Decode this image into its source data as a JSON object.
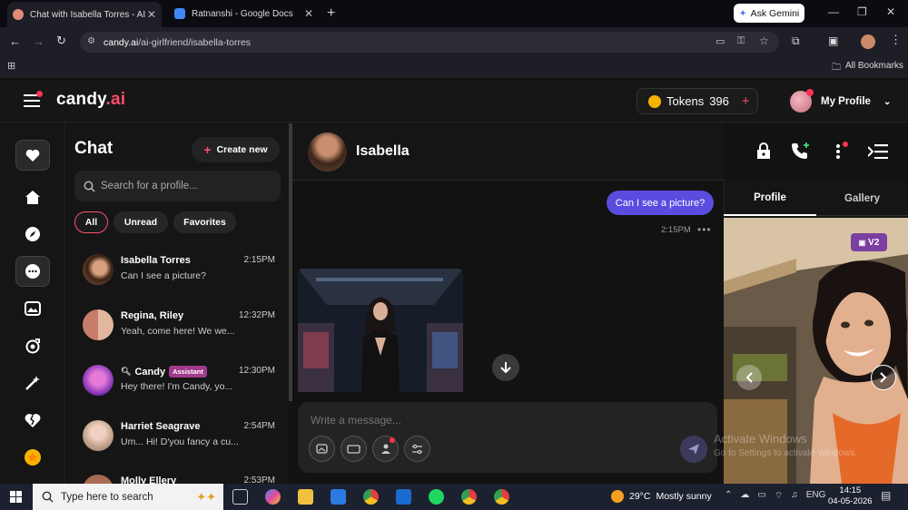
{
  "browser": {
    "tabs": [
      {
        "title": "Chat with Isabella Torres - AI G…",
        "active": true
      },
      {
        "title": "Ratnanshi - Google Docs",
        "active": false
      }
    ],
    "ask_gemini": "Ask Gemini",
    "url_host": "candy.ai",
    "url_path": "/ai-girlfriend/isabella-torres",
    "all_bookmarks": "All Bookmarks"
  },
  "header": {
    "logo_main": "candy",
    "logo_suffix": ".ai",
    "tokens_label": "Tokens",
    "tokens_count": "396",
    "tokens_plus": "+",
    "profile_label": "My Profile"
  },
  "chatlist": {
    "title": "Chat",
    "create_new": "Create new",
    "search_placeholder": "Search for a profile...",
    "filters": [
      "All",
      "Unread",
      "Favorites"
    ],
    "items": [
      {
        "name": "Isabella Torres",
        "preview": "Can I see a picture?",
        "time": "2:15PM"
      },
      {
        "name": "Regina, Riley",
        "preview": "Yeah, come here! We we...",
        "time": "12:32PM"
      },
      {
        "name": "Candy",
        "badge": "Assistant",
        "preview": "Hey there! I'm Candy, yo...",
        "time": "12:30PM"
      },
      {
        "name": "Harriet Seagrave",
        "preview": "Um... Hi! D'you fancy a cu...",
        "time": "2:54PM"
      },
      {
        "name": "Molly Ellery",
        "preview": "",
        "time": "2:53PM"
      }
    ]
  },
  "chat": {
    "name": "Isabella",
    "messages": [
      {
        "text": "Can I see a picture?",
        "time": "2:15PM"
      }
    ],
    "input_placeholder": "Write a message..."
  },
  "rightpanel": {
    "tabs": [
      "Profile",
      "Gallery"
    ],
    "badge": "V2"
  },
  "watermark": {
    "line1": "Activate Windows",
    "line2": "Go to Settings to activate Windows."
  },
  "taskbar": {
    "search_placeholder": "Type here to search",
    "weather_temp": "29°C",
    "weather_text": "Mostly sunny",
    "language": "ENG",
    "time": "14:15",
    "date": "04-05-2026"
  },
  "colors": {
    "accent": "#ff4d6d",
    "bubble": "#5b4ce0",
    "assistant_badge": "#a23a8b"
  }
}
